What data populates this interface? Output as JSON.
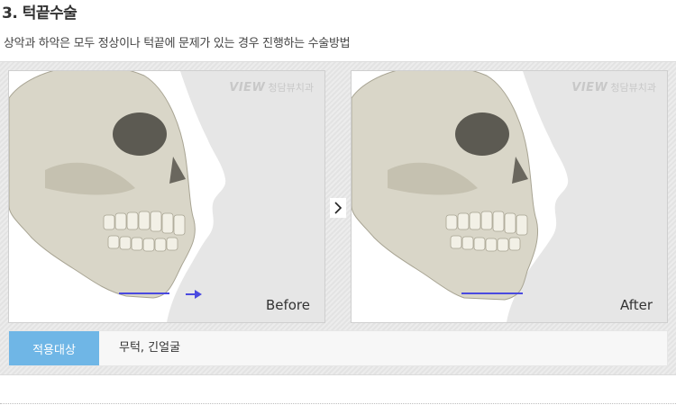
{
  "section": {
    "title": "3. 턱끝수술",
    "subtitle": "상악과 하악은 모두 정상이나 턱끝에 문제가 있는 경우 진행하는 수술방법"
  },
  "logo": {
    "brand": "VIEW",
    "clinic": "청담뷰치과"
  },
  "images": {
    "before_caption": "Before",
    "after_caption": "After"
  },
  "nav": {
    "next_icon": "chevron-right-icon"
  },
  "info": {
    "tag": "적용대상",
    "value": "무턱, 긴얼굴"
  },
  "colors": {
    "tag_bg": "#6fb6e6",
    "marker": "#4a4ae0"
  }
}
